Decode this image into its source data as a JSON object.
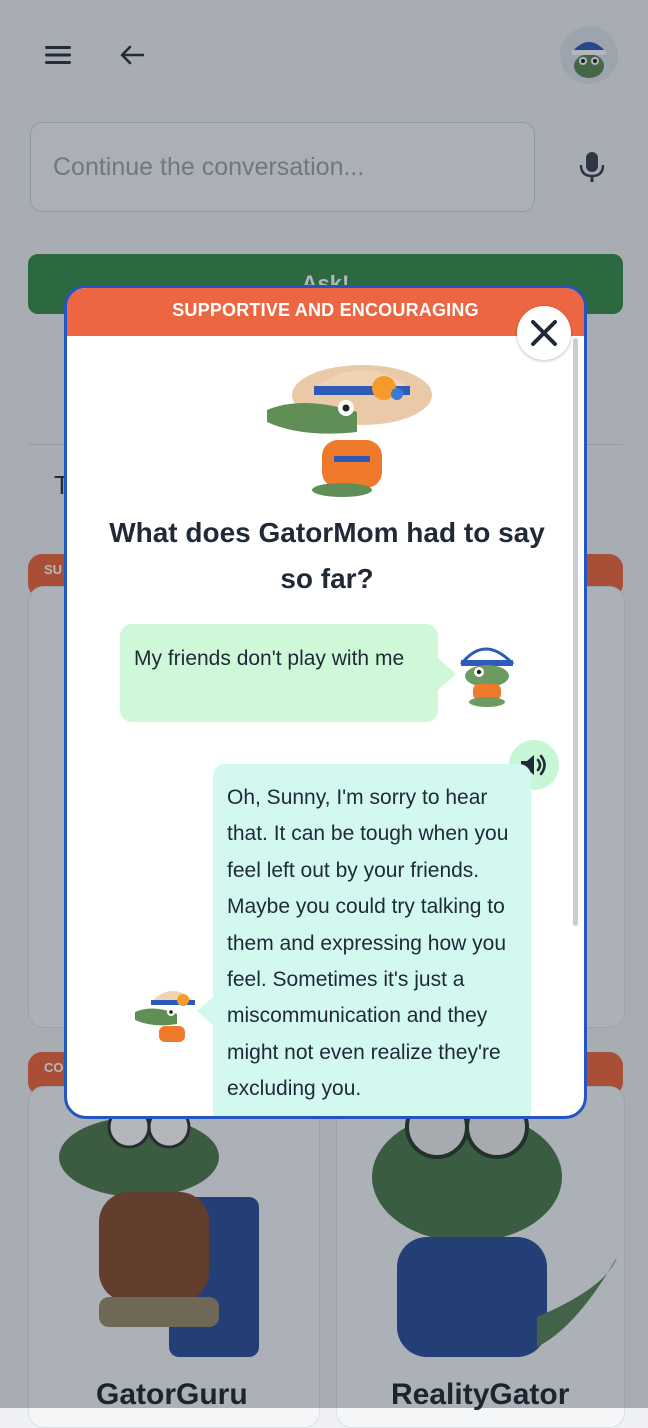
{
  "header": {
    "menu_icon": "hamburger-menu-icon",
    "back_icon": "arrow-left-icon",
    "avatar_icon": "user-gator-avatar"
  },
  "search": {
    "placeholder": "Continue the conversation...",
    "mic_icon": "microphone-icon"
  },
  "ask_button": {
    "label": "Ask!"
  },
  "background": {
    "partial_heading": "T",
    "cards": [
      {
        "tag": "SU",
        "name": ""
      },
      {
        "tag": "CO",
        "name": "GatorGuru"
      },
      {
        "tag": "",
        "name": "RealityGator"
      }
    ]
  },
  "modal": {
    "header": "SUPPORTIVE AND ENCOURAGING",
    "close_icon": "close-icon",
    "title": "What does GatorMom had to say so far?",
    "messages": [
      {
        "role": "user",
        "text": "My friends don't play with me"
      },
      {
        "role": "assistant",
        "text": "Oh, Sunny, I'm sorry to hear that. It can be tough when you feel left out by your friends. Maybe you could try talking to them and expressing how you feel. Sometimes it's just a miscommunication and they might not even realize they're excluding you."
      }
    ],
    "speaker_icon": "speaker-volume-icon"
  },
  "colors": {
    "accent_orange": "#ed6642",
    "modal_border": "#2455c3",
    "ask_green": "#3a8d4a",
    "user_bubble": "#cff8d8",
    "assistant_bubble": "#d2f8f0"
  }
}
